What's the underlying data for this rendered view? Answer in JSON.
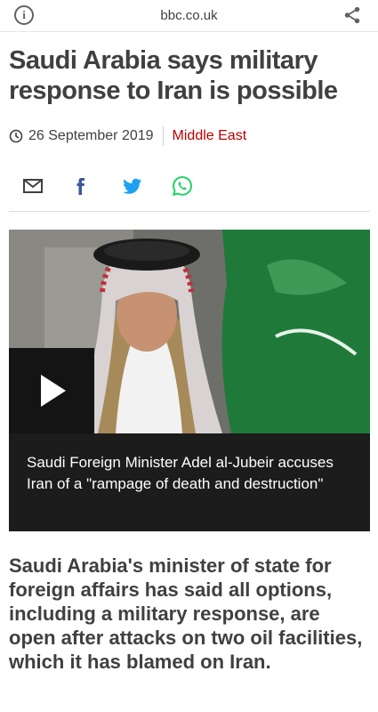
{
  "browser": {
    "url": "bbc.co.uk",
    "info_icon": "info-icon",
    "share_icon": "share-icon"
  },
  "article": {
    "headline": "Saudi Arabia says military response to Iran is possible",
    "date": "26 September 2019",
    "category": "Middle East",
    "summary": "Saudi Arabia's minister of state for foreign affairs has said all options, including a military response, are open after attacks on two oil facilities, which it has blamed on Iran."
  },
  "share": {
    "icons": [
      "email-icon",
      "facebook-icon",
      "twitter-icon",
      "whatsapp-icon"
    ]
  },
  "media": {
    "caption": "Saudi Foreign Minister Adel al-Jubeir accuses Iran of a \"rampage of death and destruction\"",
    "play_icon": "play-icon"
  },
  "colors": {
    "category": "#b80000",
    "facebook": "#3b5998",
    "twitter": "#1da1f2",
    "whatsapp": "#25d366"
  }
}
